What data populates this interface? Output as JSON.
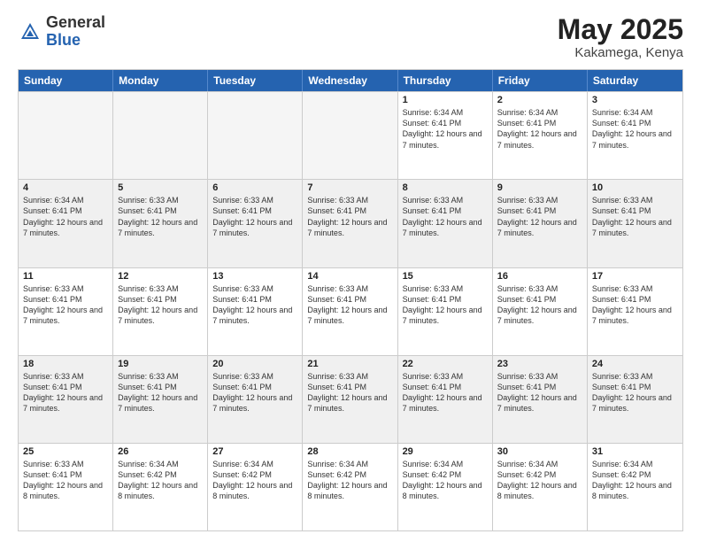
{
  "header": {
    "logo_general": "General",
    "logo_blue": "Blue",
    "title": "May 2025",
    "location": "Kakamega, Kenya"
  },
  "days_of_week": [
    "Sunday",
    "Monday",
    "Tuesday",
    "Wednesday",
    "Thursday",
    "Friday",
    "Saturday"
  ],
  "weeks": [
    [
      {
        "day": "",
        "empty": true
      },
      {
        "day": "",
        "empty": true
      },
      {
        "day": "",
        "empty": true
      },
      {
        "day": "",
        "empty": true
      },
      {
        "day": "1",
        "sunrise": "6:34 AM",
        "sunset": "6:41 PM",
        "daylight": "12 hours and 7 minutes."
      },
      {
        "day": "2",
        "sunrise": "6:34 AM",
        "sunset": "6:41 PM",
        "daylight": "12 hours and 7 minutes."
      },
      {
        "day": "3",
        "sunrise": "6:34 AM",
        "sunset": "6:41 PM",
        "daylight": "12 hours and 7 minutes."
      }
    ],
    [
      {
        "day": "4",
        "sunrise": "6:34 AM",
        "sunset": "6:41 PM",
        "daylight": "12 hours and 7 minutes."
      },
      {
        "day": "5",
        "sunrise": "6:33 AM",
        "sunset": "6:41 PM",
        "daylight": "12 hours and 7 minutes."
      },
      {
        "day": "6",
        "sunrise": "6:33 AM",
        "sunset": "6:41 PM",
        "daylight": "12 hours and 7 minutes."
      },
      {
        "day": "7",
        "sunrise": "6:33 AM",
        "sunset": "6:41 PM",
        "daylight": "12 hours and 7 minutes."
      },
      {
        "day": "8",
        "sunrise": "6:33 AM",
        "sunset": "6:41 PM",
        "daylight": "12 hours and 7 minutes."
      },
      {
        "day": "9",
        "sunrise": "6:33 AM",
        "sunset": "6:41 PM",
        "daylight": "12 hours and 7 minutes."
      },
      {
        "day": "10",
        "sunrise": "6:33 AM",
        "sunset": "6:41 PM",
        "daylight": "12 hours and 7 minutes."
      }
    ],
    [
      {
        "day": "11",
        "sunrise": "6:33 AM",
        "sunset": "6:41 PM",
        "daylight": "12 hours and 7 minutes."
      },
      {
        "day": "12",
        "sunrise": "6:33 AM",
        "sunset": "6:41 PM",
        "daylight": "12 hours and 7 minutes."
      },
      {
        "day": "13",
        "sunrise": "6:33 AM",
        "sunset": "6:41 PM",
        "daylight": "12 hours and 7 minutes."
      },
      {
        "day": "14",
        "sunrise": "6:33 AM",
        "sunset": "6:41 PM",
        "daylight": "12 hours and 7 minutes."
      },
      {
        "day": "15",
        "sunrise": "6:33 AM",
        "sunset": "6:41 PM",
        "daylight": "12 hours and 7 minutes."
      },
      {
        "day": "16",
        "sunrise": "6:33 AM",
        "sunset": "6:41 PM",
        "daylight": "12 hours and 7 minutes."
      },
      {
        "day": "17",
        "sunrise": "6:33 AM",
        "sunset": "6:41 PM",
        "daylight": "12 hours and 7 minutes."
      }
    ],
    [
      {
        "day": "18",
        "sunrise": "6:33 AM",
        "sunset": "6:41 PM",
        "daylight": "12 hours and 7 minutes."
      },
      {
        "day": "19",
        "sunrise": "6:33 AM",
        "sunset": "6:41 PM",
        "daylight": "12 hours and 7 minutes."
      },
      {
        "day": "20",
        "sunrise": "6:33 AM",
        "sunset": "6:41 PM",
        "daylight": "12 hours and 7 minutes."
      },
      {
        "day": "21",
        "sunrise": "6:33 AM",
        "sunset": "6:41 PM",
        "daylight": "12 hours and 7 minutes."
      },
      {
        "day": "22",
        "sunrise": "6:33 AM",
        "sunset": "6:41 PM",
        "daylight": "12 hours and 7 minutes."
      },
      {
        "day": "23",
        "sunrise": "6:33 AM",
        "sunset": "6:41 PM",
        "daylight": "12 hours and 7 minutes."
      },
      {
        "day": "24",
        "sunrise": "6:33 AM",
        "sunset": "6:41 PM",
        "daylight": "12 hours and 7 minutes."
      }
    ],
    [
      {
        "day": "25",
        "sunrise": "6:33 AM",
        "sunset": "6:41 PM",
        "daylight": "12 hours and 8 minutes."
      },
      {
        "day": "26",
        "sunrise": "6:34 AM",
        "sunset": "6:42 PM",
        "daylight": "12 hours and 8 minutes."
      },
      {
        "day": "27",
        "sunrise": "6:34 AM",
        "sunset": "6:42 PM",
        "daylight": "12 hours and 8 minutes."
      },
      {
        "day": "28",
        "sunrise": "6:34 AM",
        "sunset": "6:42 PM",
        "daylight": "12 hours and 8 minutes."
      },
      {
        "day": "29",
        "sunrise": "6:34 AM",
        "sunset": "6:42 PM",
        "daylight": "12 hours and 8 minutes."
      },
      {
        "day": "30",
        "sunrise": "6:34 AM",
        "sunset": "6:42 PM",
        "daylight": "12 hours and 8 minutes."
      },
      {
        "day": "31",
        "sunrise": "6:34 AM",
        "sunset": "6:42 PM",
        "daylight": "12 hours and 8 minutes."
      }
    ]
  ]
}
